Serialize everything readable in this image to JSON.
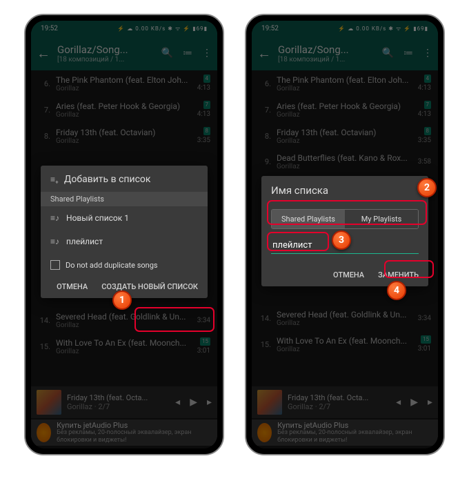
{
  "status": {
    "time": "19:52",
    "icons": "⚡ ☁ 0.00 KB/s ✱ ᯤ ⚡ ▮69▮"
  },
  "appbar": {
    "title": "Gorillaz/Song...",
    "subtitle": "[18 композиций / 1..."
  },
  "tracks": [
    {
      "n": "6.",
      "title": "The Pink Phantom (feat. Elton Joh...",
      "artist": "Gorillaz",
      "badge": "4",
      "dur": "4:13"
    },
    {
      "n": "7.",
      "title": "Aries (feat. Peter Hook & Georgia)",
      "artist": "Gorillaz",
      "badge": "7",
      "dur": "4:13"
    },
    {
      "n": "8.",
      "title": "Friday 13th (feat. Octavian)",
      "artist": "Gorillaz",
      "badge": "8",
      "dur": "3:35"
    },
    {
      "n": "9.",
      "title": "Dead Butterflies (feat. Kano & Rox...",
      "artist": "Gorillaz",
      "badge": "",
      "dur": "3:58"
    },
    {
      "n": "14.",
      "title": "Severed Head (feat. Goldlink & Un...",
      "artist": "Gorillaz",
      "badge": "",
      "dur": "3:34"
    },
    {
      "n": "15.",
      "title": "With Love To An Ex (feat. Moonch...",
      "artist": "Gorillaz",
      "badge": "15",
      "dur": "3:01"
    }
  ],
  "dialog1": {
    "title": "Добавить в список",
    "section": "Shared Playlists",
    "items": [
      "Новый список 1",
      "плейлист"
    ],
    "checkbox": "Do not add duplicate songs",
    "cancel": "ОТМЕНА",
    "create": "СОЗДАТЬ НОВЫЙ СПИСОК"
  },
  "dialog2": {
    "title": "Имя списка",
    "tab1": "Shared Playlists",
    "tab2": "My Playlists",
    "input": "плейлист",
    "cancel": "ОТМЕНА",
    "confirm": "ЗАМЕНИТЬ"
  },
  "nowplaying": {
    "title": "Friday 13th (feat. Octa...",
    "artist": "Gorillaz",
    "pos": "2/7"
  },
  "ad": {
    "title": "Купить jetAudio Plus",
    "text": "Без рекламы, 20-полосный эквалайзер, экран блокировки и виджеты!"
  },
  "badges": {
    "b1": "1",
    "b2": "2",
    "b3": "3",
    "b4": "4"
  }
}
